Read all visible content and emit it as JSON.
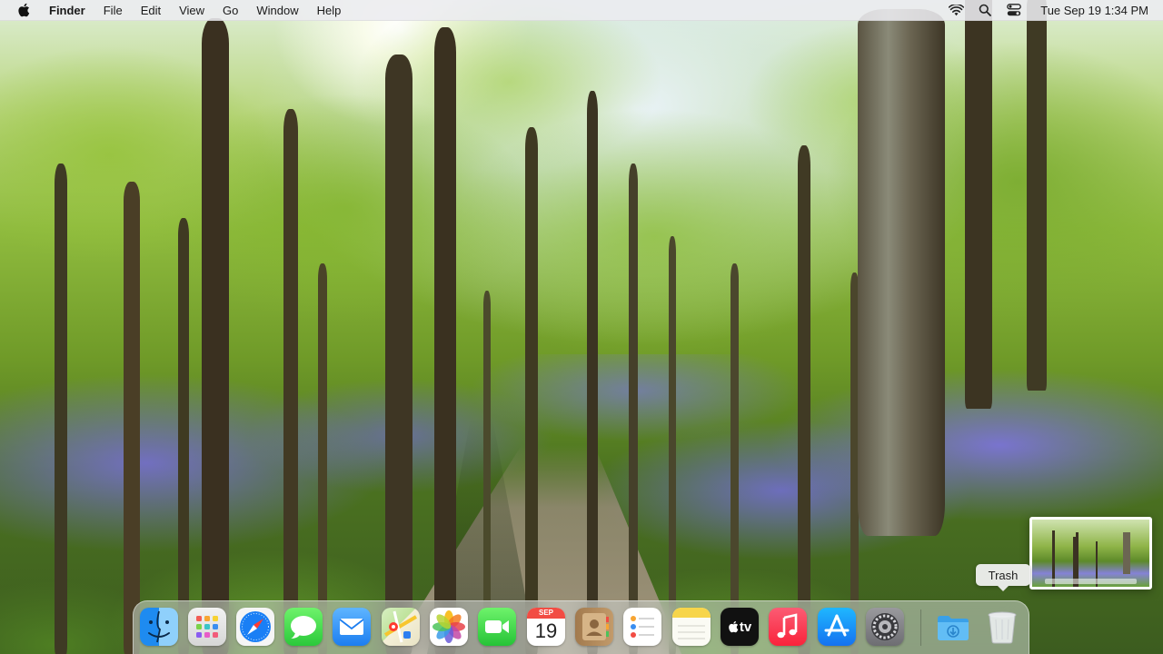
{
  "menubar": {
    "app_name": "Finder",
    "menus": [
      "File",
      "Edit",
      "View",
      "Go",
      "Window",
      "Help"
    ],
    "clock": "Tue Sep 19  1:34 PM",
    "status_icons": [
      "wifi-icon",
      "spotlight-search-icon",
      "control-center-icon"
    ]
  },
  "dock": {
    "apps": [
      {
        "name": "Finder",
        "icon": "finder-icon"
      },
      {
        "name": "Launchpad",
        "icon": "launchpad-icon"
      },
      {
        "name": "Safari",
        "icon": "safari-icon"
      },
      {
        "name": "Messages",
        "icon": "messages-icon"
      },
      {
        "name": "Mail",
        "icon": "mail-icon"
      },
      {
        "name": "Maps",
        "icon": "maps-icon"
      },
      {
        "name": "Photos",
        "icon": "photos-icon"
      },
      {
        "name": "FaceTime",
        "icon": "facetime-icon"
      },
      {
        "name": "Calendar",
        "icon": "calendar-icon"
      },
      {
        "name": "Contacts",
        "icon": "contacts-icon"
      },
      {
        "name": "Reminders",
        "icon": "reminders-icon"
      },
      {
        "name": "Notes",
        "icon": "notes-icon"
      },
      {
        "name": "TV",
        "icon": "apple-tv-icon"
      },
      {
        "name": "Music",
        "icon": "music-icon"
      },
      {
        "name": "App Store",
        "icon": "app-store-icon"
      },
      {
        "name": "System Settings",
        "icon": "system-settings-icon"
      },
      {
        "name": "Downloads",
        "icon": "downloads-folder-icon"
      },
      {
        "name": "Trash",
        "icon": "trash-icon"
      }
    ],
    "calendar_month": "SEP",
    "calendar_day": "19",
    "tv_label": "tv"
  },
  "tooltip": {
    "text": "Trash"
  },
  "colors": {
    "menubar_bg": "#ececf0",
    "dock_bg": "#dce1e1",
    "bluebell": "#7d73e1",
    "foliage": "#8fbb3e"
  }
}
